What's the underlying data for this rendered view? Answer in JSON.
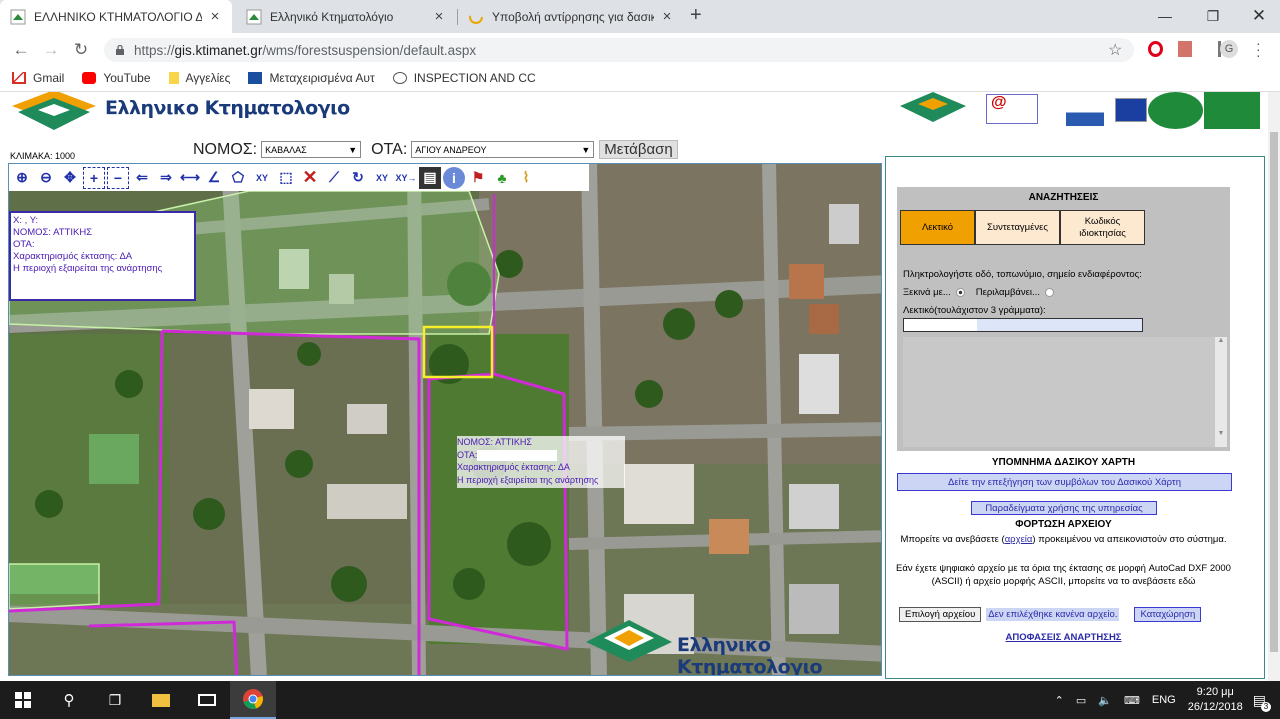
{
  "browser": {
    "tabs": [
      {
        "title": "ΕΛΛΗΝΙΚΟ ΚΤΗΜΑΤΟΛΟΓΙΟ Δασ",
        "active": true
      },
      {
        "title": "Ελληνικό Κτηματολόγιο",
        "active": false
      },
      {
        "title": "Υποβολή αντίρρησης για δασικο",
        "active": false
      }
    ],
    "new_tab": "+",
    "url_secure": "https://",
    "url_host": "gis.ktimanet.gr",
    "url_path": "/wms/forestsuspension/default.aspx",
    "profile_initial": "G"
  },
  "bookmarks": [
    {
      "label": "Gmail",
      "icon": "gmail-icon",
      "color": "#d93025"
    },
    {
      "label": "YouTube",
      "icon": "youtube-icon",
      "color": "#ff0000"
    },
    {
      "label": "Αγγελίες",
      "icon": "bookmark-folder-icon",
      "color": "#f9d649"
    },
    {
      "label": "Μεταχειρισμένα Αυτ",
      "icon": "car-site-icon",
      "color": "#1a4fa0"
    },
    {
      "label": "INSPECTION AND CC",
      "icon": "inspection-icon",
      "color": "#555555"
    }
  ],
  "header": {
    "logo_text": "Ελληνικο Κτηματολογιο",
    "nomos_label": "ΝΟΜΟΣ:",
    "nomos_value": "ΚΑΒΑΛΑΣ",
    "ota_label": "ΟΤΑ:",
    "ota_value": "ΑΓΙΟΥ ΑΝΔΡΕΟΥ",
    "go_button": "Μετάβαση",
    "scale": "ΚΛΙΜΑΚΑ: 1000"
  },
  "map": {
    "info_box": {
      "xy": "X:                    , Y:",
      "nomos": "ΝΟΜΟΣ: ΑΤΤΙΚΗΣ",
      "ota": "ΟΤΑ:",
      "characterization": "Χαρακτηρισμός έκτασης: ΔΑ",
      "exclusion": "Η περιοχή εξαιρείται της ανάρτησης"
    },
    "popup": {
      "nomos": "ΝΟΜΟΣ: ΑΤΤΙΚΗΣ",
      "ota": "ΟΤΑ:",
      "characterization": "Χαρακτηρισμός έκτασης: ΔΑ",
      "exclusion": "Η περιοχή εξαιρείται της ανάρτησης"
    },
    "watermark": "Ελληνικο Κτηματολογιο"
  },
  "search": {
    "title": "ΑΝΑΖΗΤΗΣΕΙΣ",
    "tabs": [
      "Λεκτικό",
      "Συντεταγμένες",
      "Κωδικός ιδιοκτησίας"
    ],
    "active_tab": "Λεκτικό",
    "active_color": "#f0a000",
    "inactive_color": "#fde9d0",
    "prompt": "Πληκτρολογήστε οδό, τοπωνύμιο, σημείο ενδιαφέροντος:",
    "starts_with": "Ξεκινά με...",
    "contains": "Περιλαμβάνει...",
    "text_label": "Λεκτικό(τουλάχιστον 3 γράμματα):",
    "text_value": ""
  },
  "legend": {
    "title": "ΥΠΟΜΝΗΜΑ ΔΑΣΙΚΟΥ ΧΑΡΤΗ",
    "button": "Δείτε την επεξήγηση των συμβόλων του Δασικού Χάρτη",
    "examples_button": "Παραδείγματα χρήσης της υπηρεσίας"
  },
  "upload": {
    "title": "ΦΟΡΤΩΣΗ ΑΡΧΕΙΟΥ",
    "text1_a": "Μπορείτε να ανεβάσετε (",
    "text1_link": "αρχεία",
    "text1_b": ") προκειμένου να απεικονιστούν στο σύστημα.",
    "text2": "Εάν έχετε ψηφιακό αρχείο με τα όρια της έκτασης σε μορφή AutoCad DXF 2000 (ASCII) ή αρχείο μορφής ASCII, μπορείτε να το ανεβάσετε εδώ",
    "choose_file": "Επιλογή αρχείου",
    "no_file": "Δεν επιλέχθηκε κανένα αρχείο.",
    "submit": "Καταχώρηση",
    "decisions": "ΑΠΟΦΑΣΕΙΣ ΑΝΑΡΤΗΣΗΣ"
  },
  "taskbar": {
    "language": "ENG",
    "time": "9:20 μμ",
    "date": "26/12/2018",
    "notifications": "3"
  }
}
